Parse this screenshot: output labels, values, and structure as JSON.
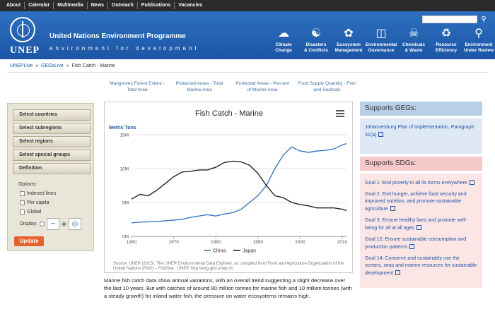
{
  "topnav": [
    "About",
    "Calendar",
    "Multimedia",
    "News",
    "Outreach",
    "Publications",
    "Vacancies"
  ],
  "header": {
    "logo": "UNEP",
    "org_name": "United Nations Environment Programme",
    "tagline": "environment for development",
    "search_icon": "magnifier-icon",
    "themes": [
      {
        "icon": "climate-icon",
        "line1": "Climate",
        "line2": "Change"
      },
      {
        "icon": "disasters-icon",
        "line1": "Disasters",
        "line2": "& Conflicts"
      },
      {
        "icon": "ecosystem-icon",
        "line1": "Ecosystem",
        "line2": "Management"
      },
      {
        "icon": "governance-icon",
        "line1": "Environmental",
        "line2": "Governance"
      },
      {
        "icon": "chemicals-icon",
        "line1": "Chemicals",
        "line2": "& Waste"
      },
      {
        "icon": "resource-icon",
        "line1": "Resource",
        "line2": "Efficiency"
      },
      {
        "icon": "review-icon",
        "line1": "Environment",
        "line2": "Under Review"
      }
    ]
  },
  "breadcrumb": {
    "link1": "UNEPLive",
    "link2": "GEGsLive",
    "current": "Fish Catch - Marine"
  },
  "related": [
    {
      "line1": "Mangroves Forest Extent -",
      "line2": "Total Area"
    },
    {
      "line1": "Protected Areas - Total",
      "line2": "Marine Area"
    },
    {
      "line1": "Protected Areas - Percent",
      "line2": "of Marine Area"
    },
    {
      "line1": "Food Supply Quantity - Fish",
      "line2": "and Seafood"
    }
  ],
  "left_panel": {
    "buttons": [
      "Select countries",
      "Select subregions",
      "Select regions",
      "Select special groups",
      "Definition"
    ],
    "options_title": "Options:",
    "options": [
      "Indexed lines",
      "Per capita",
      "Global"
    ],
    "display_label": "Display:",
    "update": "Update"
  },
  "chart": {
    "title": "Fish Catch - Marine",
    "y_label": "Metric Tons",
    "source": "Source: UNEP (2015). The UNEP Environmental Data Explorer, as compiled from Food and Agriculture Organization of the United Nations (FAO) – FishStat . UNEP. http://edg.grid.unep.ch."
  },
  "chart_data": {
    "type": "line",
    "ylabel": "Metric Tons",
    "ylim": [
      0,
      15000000
    ],
    "xlim": [
      1960,
      2011
    ],
    "y_ticks": [
      "0M",
      "5M",
      "10M",
      "15M"
    ],
    "x_ticks": [
      "1960",
      "1970",
      "1980",
      "1990",
      "2000",
      "2010"
    ],
    "legend_position": "bottom",
    "series": [
      {
        "name": "China",
        "color": "#3a79c2",
        "x": [
          1960,
          1962,
          1964,
          1966,
          1968,
          1970,
          1972,
          1974,
          1976,
          1978,
          1980,
          1982,
          1984,
          1986,
          1988,
          1990,
          1992,
          1994,
          1996,
          1998,
          2000,
          2002,
          2004,
          2006,
          2008,
          2010,
          2011
        ],
        "values": [
          2000000,
          2100000,
          2150000,
          2200000,
          2300000,
          2400000,
          2500000,
          2800000,
          3000000,
          3200000,
          3000000,
          3300000,
          3500000,
          4000000,
          5000000,
          6000000,
          7500000,
          10000000,
          12000000,
          13200000,
          12600000,
          12400000,
          12600000,
          12700000,
          12900000,
          13500000,
          13700000
        ]
      },
      {
        "name": "Japan",
        "color": "#222222",
        "x": [
          1960,
          1962,
          1964,
          1966,
          1968,
          1970,
          1972,
          1974,
          1976,
          1978,
          1980,
          1982,
          1984,
          1986,
          1988,
          1990,
          1992,
          1994,
          1996,
          1998,
          2000,
          2002,
          2004,
          2006,
          2008,
          2010,
          2011
        ],
        "values": [
          5500000,
          6200000,
          6000000,
          6800000,
          7800000,
          8800000,
          9500000,
          9600000,
          9800000,
          9800000,
          10200000,
          10900000,
          11100000,
          11000000,
          10500000,
          9300000,
          7500000,
          6000000,
          5700000,
          5000000,
          4700000,
          4500000,
          4200000,
          4200000,
          4200000,
          4000000,
          3800000
        ]
      }
    ]
  },
  "description": "Marine fish catch data show annual variations, with an overall trend suggesting a slight decrease over the last 10 years. But with catches of around 80 million tonnes for marine fish and 10 million tonnes (with a steady growth) for inland water fish, the pressure on water ecosystems remains high.",
  "gegs": {
    "title": "Supports GEGs:",
    "items": [
      "Johannesburg Plan of Implementation, Paragraph 31(a)"
    ]
  },
  "sdgs": {
    "title": "Supports SDGs:",
    "items": [
      "Goal 1: End poverty in all its forms everywhere",
      "Goal 2: End hunger, achieve food security and improved nutrition, and promote sustainable agriculture",
      "Goal 3: Ensure healthy lives and promote well-being for all at all ages",
      "Goal 12: Ensure sustainable consumption and production patterns",
      "Goal 14: Conserve and sustainably use the oceans, seas and marine resources for sustainable development"
    ]
  }
}
